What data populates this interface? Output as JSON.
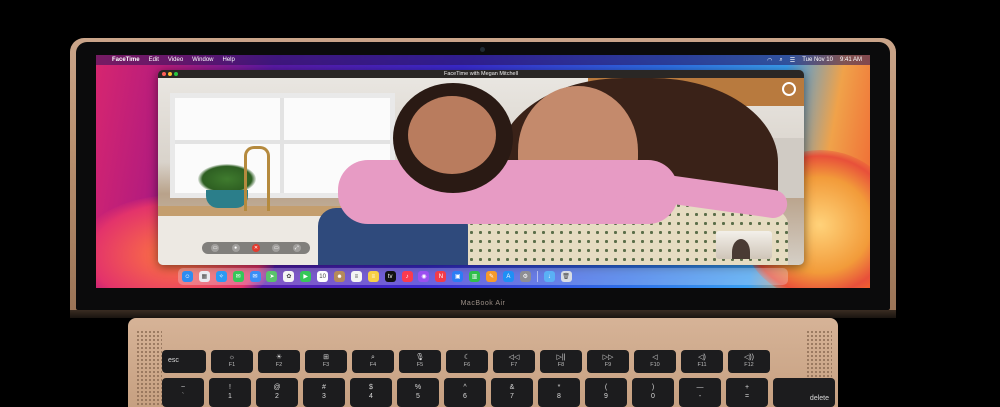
{
  "device": {
    "brand_label": "MacBook Air"
  },
  "menubar": {
    "app_name": "FaceTime",
    "items": [
      "Edit",
      "Video",
      "Window",
      "Help"
    ],
    "clock": "Tue Nov 10",
    "time": "9:41 AM"
  },
  "facetime": {
    "window_title": "FaceTime with Megan Mitchell",
    "controls": [
      "sidebar-icon",
      "mute-icon",
      "end-call-icon",
      "camera-icon",
      "fullscreen-icon"
    ]
  },
  "dock": {
    "apps": [
      {
        "name": "finder-icon",
        "color": "#2f8cf0",
        "glyph": "☺"
      },
      {
        "name": "launchpad-icon",
        "color": "#e9e9f0",
        "glyph": "▦"
      },
      {
        "name": "safari-icon",
        "color": "#2b9af3",
        "glyph": "✧"
      },
      {
        "name": "messages-icon",
        "color": "#35c759",
        "glyph": "✉"
      },
      {
        "name": "mail-icon",
        "color": "#3a8ef6",
        "glyph": "✉"
      },
      {
        "name": "maps-icon",
        "color": "#5ac26b",
        "glyph": "➤"
      },
      {
        "name": "photos-icon",
        "color": "#f4f4f4",
        "glyph": "✿"
      },
      {
        "name": "facetime-icon",
        "color": "#35c759",
        "glyph": "▶"
      },
      {
        "name": "calendar-icon",
        "color": "#ffffff",
        "glyph": "10"
      },
      {
        "name": "contacts-icon",
        "color": "#b58a5a",
        "glyph": "☻"
      },
      {
        "name": "reminders-icon",
        "color": "#f4f4f4",
        "glyph": "≡"
      },
      {
        "name": "notes-icon",
        "color": "#f7d046",
        "glyph": "≡"
      },
      {
        "name": "tv-icon",
        "color": "#111111",
        "glyph": "tv"
      },
      {
        "name": "music-icon",
        "color": "#fa3b4f",
        "glyph": "♪"
      },
      {
        "name": "podcasts-icon",
        "color": "#9b4ff0",
        "glyph": "◉"
      },
      {
        "name": "news-icon",
        "color": "#f23b4a",
        "glyph": "N"
      },
      {
        "name": "keynote-icon",
        "color": "#2c7cf5",
        "glyph": "▣"
      },
      {
        "name": "numbers-icon",
        "color": "#2fbf4a",
        "glyph": "▥"
      },
      {
        "name": "pages-icon",
        "color": "#f59a2c",
        "glyph": "✎"
      },
      {
        "name": "app-store-icon",
        "color": "#1e8ff5",
        "glyph": "A"
      },
      {
        "name": "system-preferences-icon",
        "color": "#8e8e93",
        "glyph": "⚙"
      },
      {
        "name": "downloads-folder-icon",
        "color": "#5ab0f5",
        "glyph": "↓"
      },
      {
        "name": "trash-icon",
        "color": "#d9dde3",
        "glyph": "🗑"
      }
    ]
  },
  "keyboard": {
    "function_row": [
      {
        "label": "esc",
        "sub": ""
      },
      {
        "label": "☼",
        "sub": "F1"
      },
      {
        "label": "☀",
        "sub": "F2"
      },
      {
        "label": "⊞",
        "sub": "F3"
      },
      {
        "label": "⌕",
        "sub": "F4"
      },
      {
        "label": "🎙",
        "sub": "F5"
      },
      {
        "label": "☾",
        "sub": "F6"
      },
      {
        "label": "◁◁",
        "sub": "F7"
      },
      {
        "label": "▷||",
        "sub": "F8"
      },
      {
        "label": "▷▷",
        "sub": "F9"
      },
      {
        "label": "◁",
        "sub": "F10"
      },
      {
        "label": "◁)",
        "sub": "F11"
      },
      {
        "label": "◁))",
        "sub": "F12"
      }
    ],
    "number_row": [
      {
        "top": "~",
        "bottom": "`"
      },
      {
        "top": "!",
        "bottom": "1"
      },
      {
        "top": "@",
        "bottom": "2"
      },
      {
        "top": "#",
        "bottom": "3"
      },
      {
        "top": "$",
        "bottom": "4"
      },
      {
        "top": "%",
        "bottom": "5"
      },
      {
        "top": "^",
        "bottom": "6"
      },
      {
        "top": "&",
        "bottom": "7"
      },
      {
        "top": "*",
        "bottom": "8"
      },
      {
        "top": "(",
        "bottom": "9"
      },
      {
        "top": ")",
        "bottom": "0"
      },
      {
        "top": "—",
        "bottom": "-"
      },
      {
        "top": "+",
        "bottom": "="
      }
    ],
    "delete_label": "delete"
  }
}
